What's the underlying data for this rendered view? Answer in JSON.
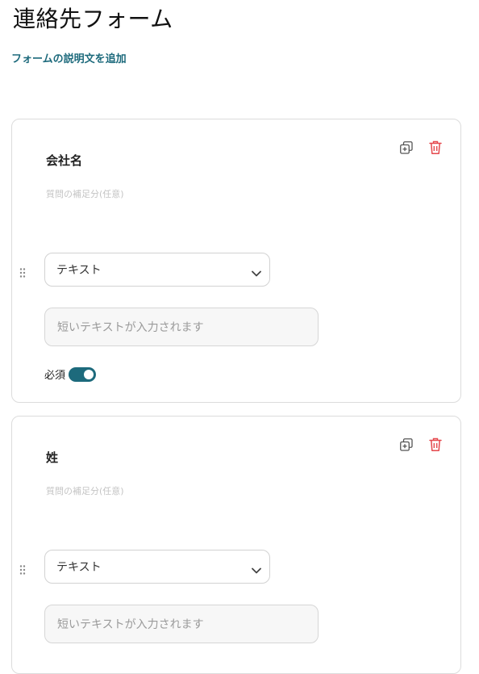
{
  "form": {
    "title": "連絡先フォーム",
    "description_link": "フォームの説明文を追加"
  },
  "questions": [
    {
      "title": "会社名",
      "subtitle_placeholder": "質問の補足分(任意)",
      "type_label": "テキスト",
      "preview_placeholder": "短いテキストが入力されます",
      "required_label": "必須",
      "required": true
    },
    {
      "title": "姓",
      "subtitle_placeholder": "質問の補足分(任意)",
      "type_label": "テキスト",
      "preview_placeholder": "短いテキストが入力されます"
    }
  ],
  "colors": {
    "accent": "#1d6a7c",
    "delete": "#e5484d",
    "icon_gray": "#555555"
  },
  "icons": {
    "copy": "duplicate-icon",
    "delete": "trash-icon",
    "drag": "drag-handle-icon",
    "dropdown": "chevron-down-icon"
  }
}
